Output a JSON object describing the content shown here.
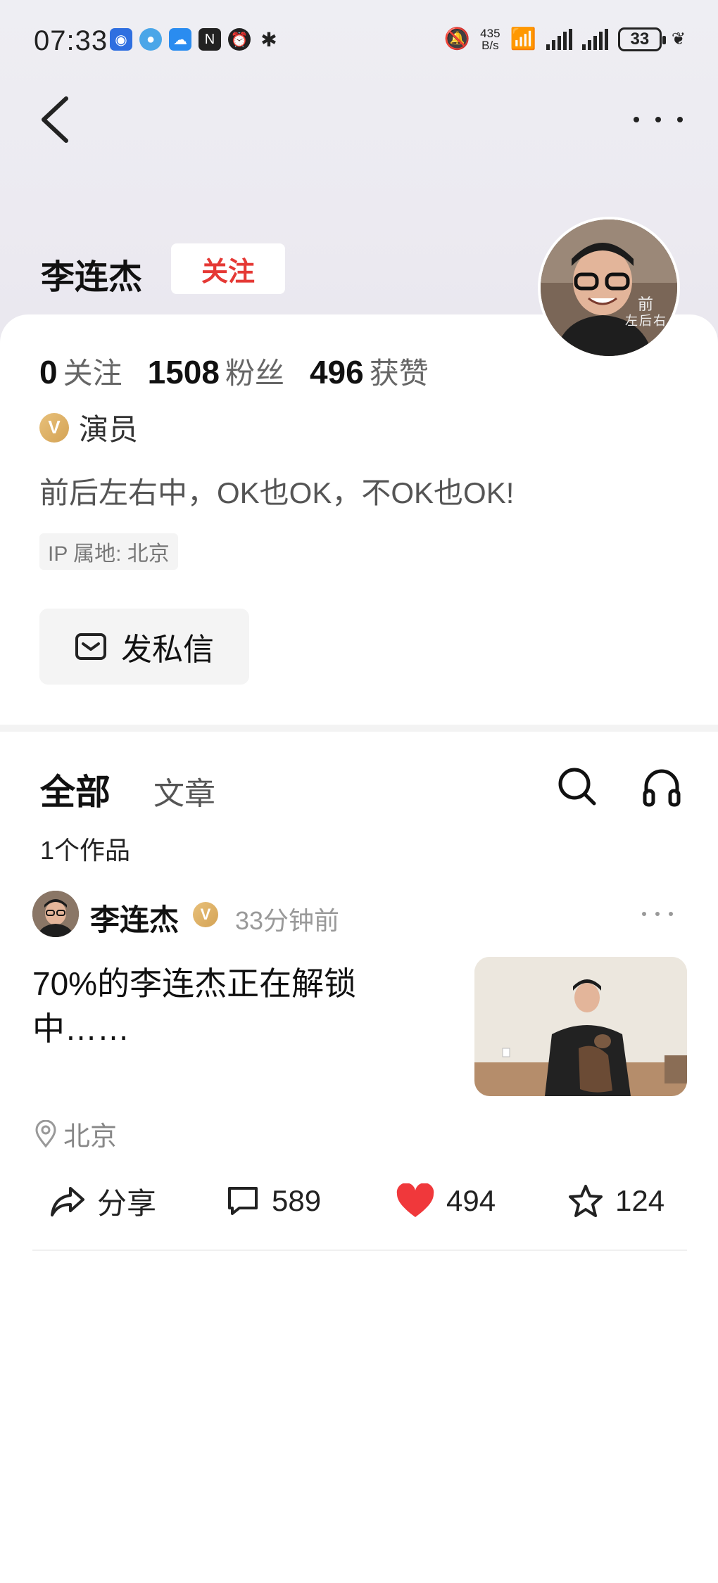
{
  "status_bar": {
    "time": "07:33",
    "net_speed_value": "435",
    "net_speed_unit": "B/s",
    "battery": "33"
  },
  "profile": {
    "name": "李连杰",
    "follow_label": "关注",
    "stats": [
      {
        "num": "0",
        "label": "关注"
      },
      {
        "num": "1508",
        "label": "粉丝"
      },
      {
        "num": "496",
        "label": "获赞"
      }
    ],
    "verify_badge": "V",
    "verify_text": "演员",
    "bio": "前后左右中，OK也OK，不OK也OK!",
    "ip": "IP 属地: 北京",
    "message_label": "发私信",
    "avatar_text": "前后\n左右"
  },
  "tabs": {
    "all": "全部",
    "article": "文章",
    "works_count": "1个作品"
  },
  "post": {
    "author": "李连杰",
    "time": "33分钟前",
    "text": "70%的李连杰正在解锁中……",
    "location": "北京",
    "share_label": "分享",
    "comments": "589",
    "likes": "494",
    "favorites": "124"
  },
  "colors": {
    "follow": "#e53935",
    "like": "#f0383b",
    "verify": "#d9a95b"
  }
}
